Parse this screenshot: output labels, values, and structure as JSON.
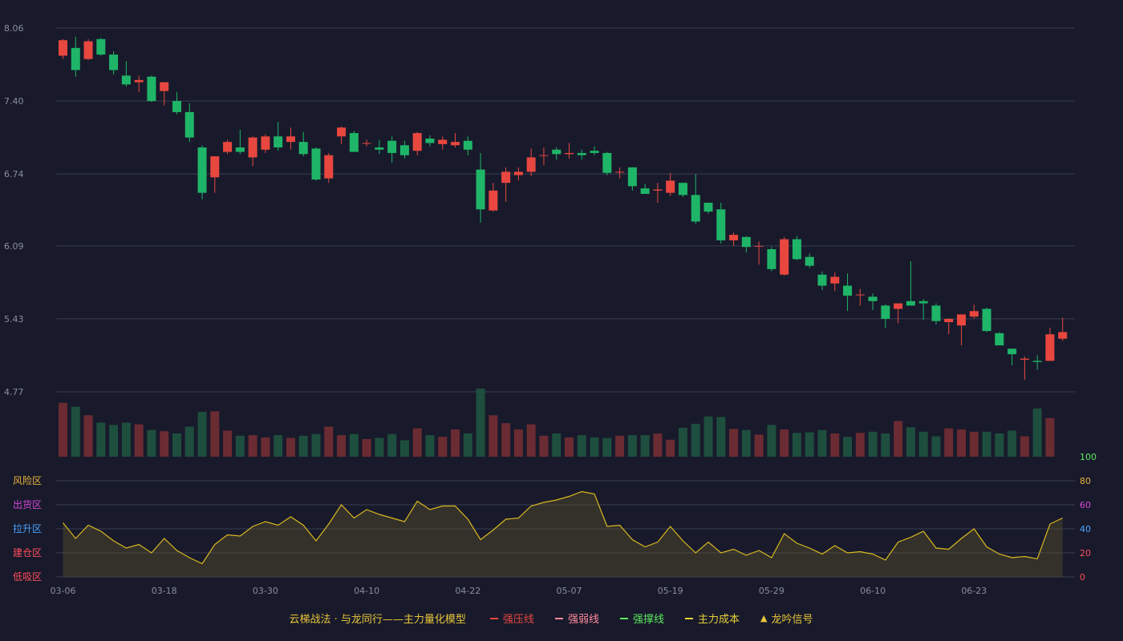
{
  "colors": {
    "background": "#181a2b",
    "up": "#e8473f",
    "down": "#1fb568",
    "vol_up": "#6b2b32",
    "vol_down": "#1e4e3e",
    "line": "#d9b81e",
    "grid": "#3a3d52",
    "axis_text": "#8a8d9e",
    "risk": "#e8b23a",
    "distribute": "#d247d8",
    "rise": "#4aa3ff",
    "build": "#ff4d5a",
    "lowbuy": "#ff4d5a"
  },
  "legend": {
    "title": "云梯战法 · 与龙同行——主力量化模型",
    "items": [
      {
        "label": "强压线",
        "color": "#e8473f",
        "style": "solid"
      },
      {
        "label": "强弱线",
        "color": "#ff8a9a",
        "style": "dash"
      },
      {
        "label": "强撑线",
        "color": "#5de85d",
        "style": "solid"
      },
      {
        "label": "主力成本",
        "color": "#e8d23a",
        "style": "dash"
      },
      {
        "label": "龙吟信号",
        "color": "#e8c53a",
        "style": "triangle"
      }
    ]
  },
  "chart_data": [
    {
      "type": "candlestick",
      "y_ticks": [
        "8.06",
        "7.40",
        "6.74",
        "6.09",
        "5.43",
        "4.77"
      ],
      "ylim": [
        4.77,
        8.06
      ],
      "x_labels": [
        {
          "index": 0,
          "label": "03-06"
        },
        {
          "index": 8,
          "label": "03-18"
        },
        {
          "index": 16,
          "label": "03-30"
        },
        {
          "index": 24,
          "label": "04-10"
        },
        {
          "index": 32,
          "label": "04-22"
        },
        {
          "index": 40,
          "label": "05-07"
        },
        {
          "index": 48,
          "label": "05-19"
        },
        {
          "index": 56,
          "label": "05-29"
        },
        {
          "index": 64,
          "label": "06-10"
        },
        {
          "index": 72,
          "label": "06-23"
        }
      ],
      "ohlc": [
        [
          7.81,
          7.96,
          7.78,
          7.95
        ],
        [
          7.88,
          7.98,
          7.62,
          7.68
        ],
        [
          7.78,
          7.96,
          7.77,
          7.94
        ],
        [
          7.96,
          7.97,
          7.81,
          7.82
        ],
        [
          7.82,
          7.85,
          7.64,
          7.68
        ],
        [
          7.63,
          7.76,
          7.53,
          7.55
        ],
        [
          7.57,
          7.63,
          7.48,
          7.59
        ],
        [
          7.62,
          7.63,
          7.39,
          7.4
        ],
        [
          7.49,
          7.56,
          7.36,
          7.57
        ],
        [
          7.4,
          7.48,
          7.28,
          7.3
        ],
        [
          7.3,
          7.38,
          7.03,
          7.07
        ],
        [
          6.98,
          7.0,
          6.51,
          6.57
        ],
        [
          6.71,
          6.9,
          6.57,
          6.9
        ],
        [
          6.94,
          7.05,
          6.92,
          7.03
        ],
        [
          6.98,
          7.14,
          6.92,
          6.94
        ],
        [
          6.89,
          7.08,
          6.81,
          7.07
        ],
        [
          6.96,
          7.1,
          6.93,
          7.08
        ],
        [
          7.08,
          7.21,
          6.95,
          6.98
        ],
        [
          7.03,
          7.16,
          6.96,
          7.08
        ],
        [
          7.03,
          7.12,
          6.9,
          6.92
        ],
        [
          6.97,
          6.98,
          6.68,
          6.69
        ],
        [
          6.7,
          6.93,
          6.66,
          6.91
        ],
        [
          7.08,
          7.17,
          7.01,
          7.16
        ],
        [
          7.11,
          7.13,
          6.94,
          6.94
        ],
        [
          7.02,
          7.05,
          6.99,
          7.02
        ],
        [
          6.98,
          7.05,
          6.92,
          6.96
        ],
        [
          7.04,
          7.08,
          6.84,
          6.93
        ],
        [
          7.0,
          7.04,
          6.88,
          6.91
        ],
        [
          6.95,
          7.12,
          6.91,
          7.11
        ],
        [
          7.06,
          7.09,
          6.99,
          7.02
        ],
        [
          7.01,
          7.08,
          6.96,
          7.05
        ],
        [
          7.0,
          7.11,
          6.98,
          7.03
        ],
        [
          7.04,
          7.08,
          6.91,
          6.96
        ],
        [
          6.78,
          6.93,
          6.3,
          6.42
        ],
        [
          6.41,
          6.66,
          6.4,
          6.59
        ],
        [
          6.66,
          6.8,
          6.49,
          6.76
        ],
        [
          6.73,
          6.8,
          6.68,
          6.76
        ],
        [
          6.76,
          6.97,
          6.72,
          6.89
        ],
        [
          6.91,
          6.98,
          6.82,
          6.91
        ],
        [
          6.96,
          6.98,
          6.87,
          6.92
        ],
        [
          6.92,
          7.02,
          6.88,
          6.93
        ],
        [
          6.93,
          6.96,
          6.87,
          6.91
        ],
        [
          6.95,
          6.99,
          6.91,
          6.93
        ],
        [
          6.93,
          6.94,
          6.73,
          6.75
        ],
        [
          6.76,
          6.8,
          6.7,
          6.76
        ],
        [
          6.8,
          6.8,
          6.59,
          6.63
        ],
        [
          6.61,
          6.65,
          6.56,
          6.56
        ],
        [
          6.59,
          6.66,
          6.48,
          6.6
        ],
        [
          6.57,
          6.75,
          6.54,
          6.68
        ],
        [
          6.66,
          6.66,
          6.53,
          6.55
        ],
        [
          6.55,
          6.74,
          6.29,
          6.31
        ],
        [
          6.48,
          6.48,
          6.38,
          6.4
        ],
        [
          6.42,
          6.48,
          6.11,
          6.14
        ],
        [
          6.14,
          6.21,
          6.09,
          6.19
        ],
        [
          6.17,
          6.18,
          6.03,
          6.08
        ],
        [
          6.09,
          6.13,
          5.92,
          6.09
        ],
        [
          6.06,
          6.08,
          5.86,
          5.88
        ],
        [
          5.83,
          6.17,
          5.82,
          6.15
        ],
        [
          6.15,
          6.18,
          5.96,
          5.97
        ],
        [
          5.99,
          6.02,
          5.89,
          5.91
        ],
        [
          5.83,
          5.86,
          5.69,
          5.73
        ],
        [
          5.75,
          5.85,
          5.68,
          5.81
        ],
        [
          5.73,
          5.84,
          5.5,
          5.64
        ],
        [
          5.65,
          5.7,
          5.55,
          5.65
        ],
        [
          5.63,
          5.66,
          5.51,
          5.59
        ],
        [
          5.55,
          5.56,
          5.35,
          5.43
        ],
        [
          5.52,
          5.55,
          5.39,
          5.57
        ],
        [
          5.59,
          5.95,
          5.55,
          5.55
        ],
        [
          5.59,
          5.61,
          5.42,
          5.57
        ],
        [
          5.55,
          5.57,
          5.38,
          5.41
        ],
        [
          5.4,
          5.43,
          5.29,
          5.43
        ],
        [
          5.37,
          5.47,
          5.19,
          5.47
        ],
        [
          5.45,
          5.56,
          5.43,
          5.5
        ],
        [
          5.52,
          5.53,
          5.31,
          5.32
        ],
        [
          5.3,
          5.31,
          5.19,
          5.19
        ],
        [
          5.16,
          5.16,
          5.01,
          5.11
        ],
        [
          5.06,
          5.09,
          4.88,
          5.07
        ],
        [
          5.05,
          5.1,
          4.97,
          5.04
        ],
        [
          5.05,
          5.35,
          5.05,
          5.29
        ],
        [
          5.25,
          5.44,
          5.23,
          5.31
        ]
      ],
      "volume": [
        95,
        88,
        73,
        60,
        56,
        60,
        57,
        47,
        45,
        41,
        53,
        79,
        80,
        46,
        37,
        38,
        34,
        38,
        33,
        37,
        40,
        53,
        38,
        40,
        31,
        33,
        40,
        29,
        50,
        38,
        35,
        48,
        41,
        120,
        73,
        59,
        48,
        57,
        37,
        41,
        34,
        38,
        34,
        33,
        37,
        38,
        38,
        41,
        30,
        51,
        58,
        71,
        70,
        49,
        47,
        39,
        56,
        48,
        42,
        43,
        47,
        41,
        35,
        42,
        44,
        41,
        63,
        52,
        44,
        36,
        50,
        48,
        44,
        44,
        41,
        46,
        36,
        85,
        68
      ],
      "vol_ylim": [
        0,
        120
      ]
    },
    {
      "type": "line",
      "right_ticks": [
        "100",
        "80",
        "60",
        "40",
        "20",
        "0"
      ],
      "zone_labels": [
        "风险区",
        "出货区",
        "拉升区",
        "建仓区",
        "低吸区"
      ],
      "ylim": [
        0,
        100
      ],
      "values": [
        45,
        32,
        43,
        38,
        30,
        24,
        27,
        20,
        32,
        22,
        16,
        11,
        27,
        35,
        34,
        42,
        46,
        43,
        50,
        43,
        30,
        44,
        60,
        49,
        56,
        52,
        49,
        46,
        63,
        56,
        59,
        59,
        48,
        31,
        39,
        48,
        49,
        59,
        62,
        64,
        67,
        71,
        69,
        42,
        43,
        31,
        25,
        29,
        42,
        30,
        20,
        29,
        20,
        23,
        18,
        22,
        16,
        36,
        28,
        24,
        19,
        26,
        20,
        21,
        19,
        14,
        29,
        33,
        38,
        24,
        23,
        32,
        40,
        25,
        19,
        16,
        17,
        15,
        44,
        49
      ]
    }
  ]
}
